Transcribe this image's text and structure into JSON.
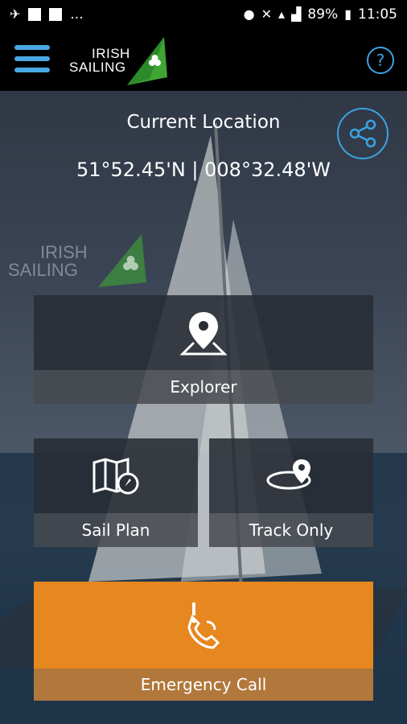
{
  "status_bar": {
    "overflow": "...",
    "battery": "89%",
    "time": "11:05"
  },
  "app_bar": {
    "logo_line1": "IRISH",
    "logo_line2": "SAILING",
    "help": "?"
  },
  "location": {
    "title": "Current Location",
    "coords": "51°52.45'N | 008°32.48'W"
  },
  "watermark": {
    "line1": "IRISH",
    "line2": "SAILING"
  },
  "tiles": {
    "explorer": "Explorer",
    "sail_plan": "Sail Plan",
    "track_only": "Track Only",
    "emergency": "Emergency Call"
  },
  "colors": {
    "accent_blue": "#3aa3e3",
    "emergency_orange": "#e6871f",
    "logo_green": "#3fa535"
  },
  "icons": {
    "menu": "hamburger-icon",
    "help": "help-icon",
    "share": "share-icon",
    "explorer": "map-pin-icon",
    "sail_plan": "folded-map-compass-icon",
    "track_only": "track-pin-icon",
    "emergency": "phone-alert-icon"
  }
}
